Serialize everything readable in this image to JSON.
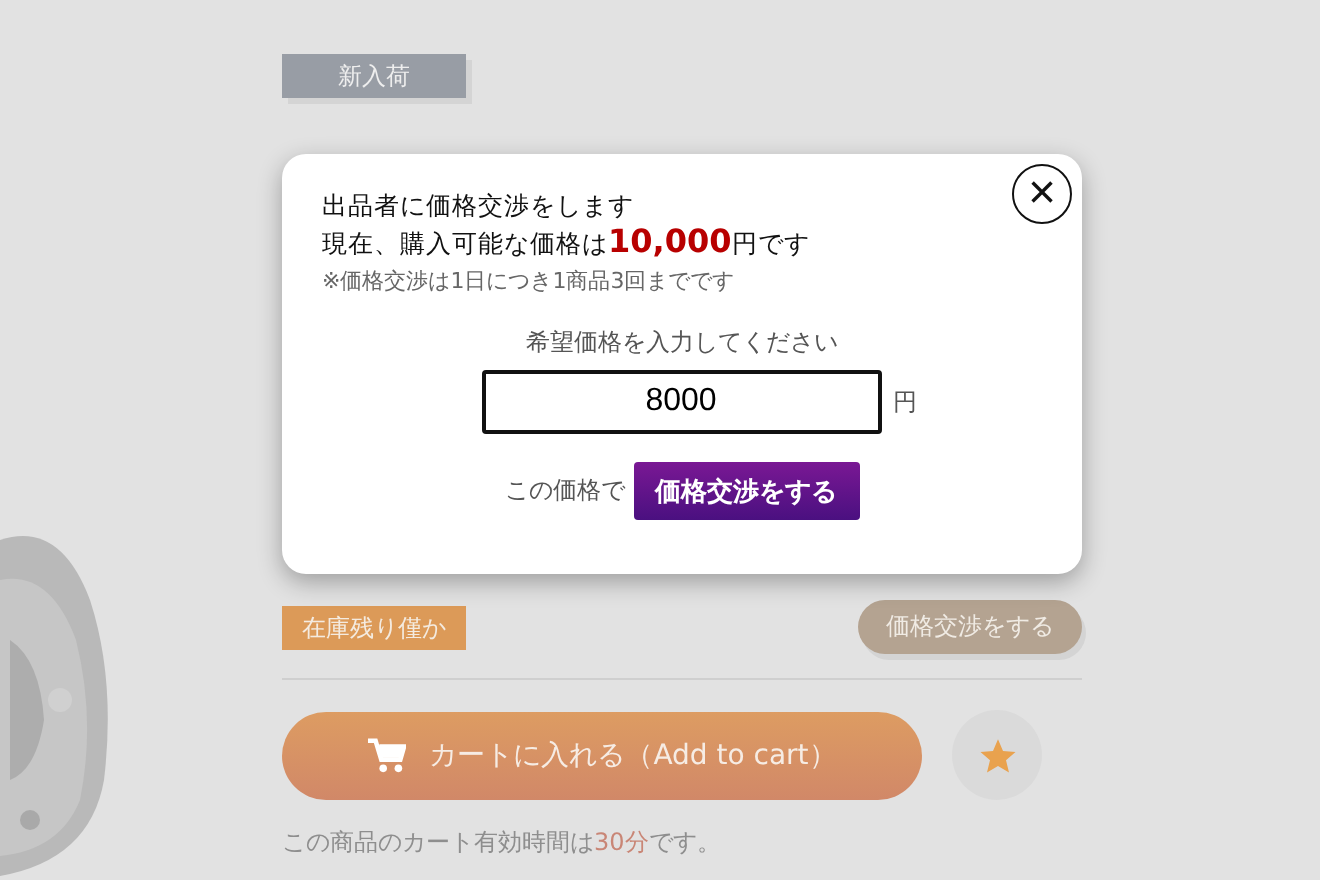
{
  "badges": [
    {
      "label": "新入荷",
      "kind": "new"
    }
  ],
  "modal": {
    "lines": [
      "出品者に価格交渉をします",
      "現在、購入可能な価格は**10,000**円です"
    ],
    "note": "※価格交渉は1日につき1商品3回までです",
    "prompt": "希望価格を入力してください",
    "value": "8000",
    "unit": "円",
    "submit_prefix": "この価格で",
    "submit": "価格交渉をする",
    "close": "×"
  },
  "stock_badge": "在庫残り僅か",
  "negotiate_button": "価格交渉をする",
  "cart_button": "カートに入れる（Add to cart）",
  "cart_note": [
    {
      "text": "この商品のカート有効時間は",
      "kind": "plain"
    },
    {
      "text": "30分",
      "kind": "highlight"
    },
    {
      "text": "です。",
      "kind": "plain"
    }
  ]
}
